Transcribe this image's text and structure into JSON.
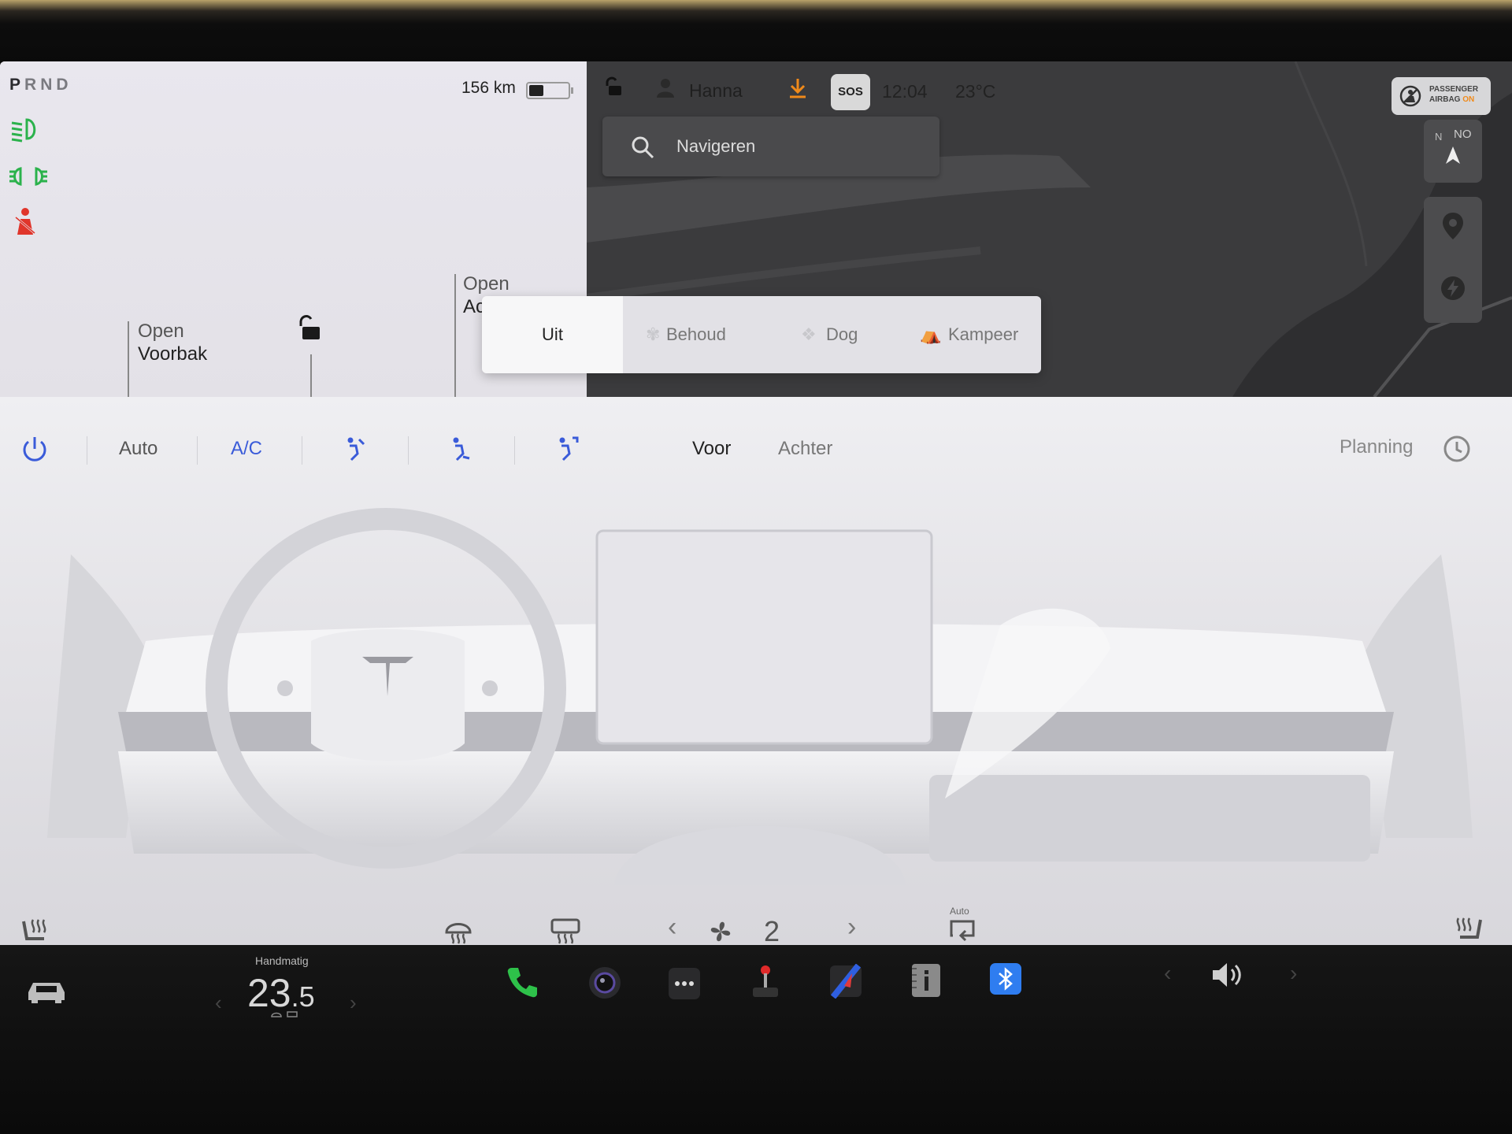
{
  "status": {
    "gears": [
      "P",
      "R",
      "N",
      "D"
    ],
    "selected_gear": "P",
    "range": "156 km",
    "battery_level": 0.38,
    "user": "Hanna",
    "time": "12:04",
    "temperature": "23°C",
    "sos_label": "SOS",
    "airbag": {
      "line1": "PASSENGER",
      "line2": "AIRBAG",
      "state": "ON"
    }
  },
  "car_panel": {
    "frunk": {
      "label": "Open",
      "value": "Voorbak"
    },
    "trunk": {
      "label": "Open",
      "value": "Ac"
    }
  },
  "map": {
    "search_placeholder": "Navigeren",
    "compass_letters": [
      "N",
      "NO"
    ]
  },
  "climate_modes": {
    "items": [
      "Uit",
      "Behoud",
      "Dog",
      "Kampeer"
    ],
    "active": "Uit"
  },
  "climate": {
    "auto_label": "Auto",
    "ac_label": "A/C",
    "front_tab": "Voor",
    "rear_tab": "Achter",
    "planning_label": "Planning",
    "fan_speed": "2",
    "recirc_label": "Auto"
  },
  "taskbar": {
    "cabin_mode": "Handmatig",
    "temp_whole": "23",
    "temp_decimal": ".5"
  },
  "colors": {
    "accent_blue": "#3a5bd9",
    "headlight_green": "#2bb24c",
    "seatbelt_red": "#e0352b",
    "download_orange": "#f08a1a",
    "phone_green": "#2ec14a",
    "bluetooth_blue": "#2f7df0"
  }
}
